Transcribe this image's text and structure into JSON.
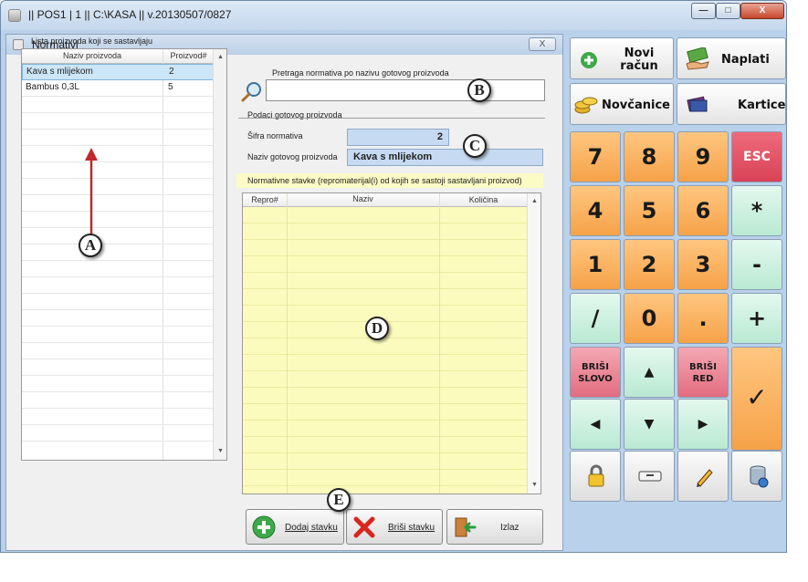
{
  "window": {
    "title": "|| POS1 | 1 || C:\\KASA || v.20130507/0827",
    "min": "—",
    "max": "□",
    "close": "X"
  },
  "dialog": {
    "title": "Normativi",
    "close": "X"
  },
  "product_list": {
    "label": "Lista proizvoda koji se sastavljaju",
    "headers": [
      "Naziv proizvoda",
      "Proizvod#"
    ],
    "rows": [
      {
        "name": "Kava s mlijekom",
        "id": "2"
      },
      {
        "name": "Bambus 0,3L",
        "id": "5"
      }
    ]
  },
  "search": {
    "label": "Pretraga normativa po nazivu gotovog proizvoda",
    "value": ""
  },
  "finished_product": {
    "section_label": "Podaci gotovog proizvoda",
    "code_label": "Šifra normativa",
    "code_value": "2",
    "name_label": "Naziv gotovog proizvoda",
    "name_value": "Kava s mlijekom"
  },
  "norm_items": {
    "note": "Normativne stavke (repromaterijal(i) od kojih se sastoji sastavljani proizvod)",
    "headers": [
      "Repro#",
      "Naziv",
      "Količina"
    ]
  },
  "buttons": {
    "add": "Dodaj stavku",
    "delete": "Briši stavku",
    "exit": "Izlaz"
  },
  "keypad": {
    "new_bill": "Novi račun",
    "charge": "Naplati",
    "cash": "Novčanice",
    "cards": "Kartice",
    "keys": [
      "7",
      "8",
      "9",
      "ESC",
      "4",
      "5",
      "6",
      "*",
      "1",
      "2",
      "3",
      "-",
      "/",
      "0",
      ".",
      "+"
    ],
    "delete_char": "BRIŠI SLOVO",
    "delete_row": "BRIŠI RED",
    "up": "▲",
    "down": "▼",
    "left": "◀",
    "right": "▶",
    "enter": "✓"
  },
  "annotations": [
    "A",
    "B",
    "C",
    "D",
    "E"
  ],
  "colors": {
    "accent_blue": "#b9d1ea",
    "key_orange": "#f6a248",
    "key_mint": "#b9e9d3",
    "key_red": "#d94257",
    "grid_yellow": "#fbfbbe",
    "field_blue": "#c6daf2",
    "arrow_red": "#c1272d"
  }
}
